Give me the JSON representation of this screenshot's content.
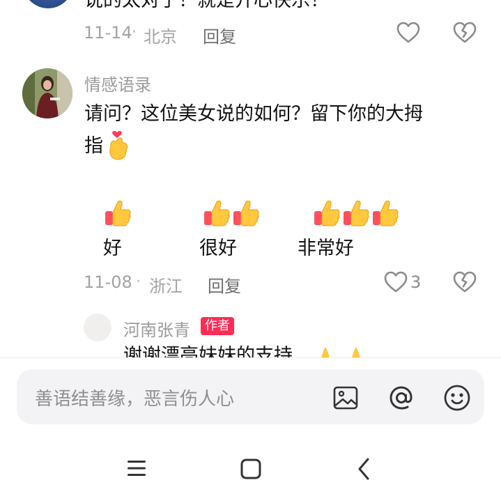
{
  "comment1": {
    "text": "说的太对了！就是开心快乐！",
    "date": "11-14",
    "location": "北京",
    "reply_label": "回复"
  },
  "comment2": {
    "author": "情感语录",
    "text_line1": "请问？这位美女说的如何？留下你的大拇",
    "text_line2": "指",
    "options": [
      {
        "thumbs": 1,
        "label": "好"
      },
      {
        "thumbs": 2,
        "label": "很好"
      },
      {
        "thumbs": 3,
        "label": "非常好"
      }
    ],
    "date": "11-08",
    "location": "浙江",
    "reply_label": "回复",
    "like_count": "3"
  },
  "reply1": {
    "author": "河南张青",
    "author_badge": "作者",
    "text": "谢谢漂亮妹妹的支持"
  },
  "input": {
    "placeholder": "善语结善缘，恶言伤人心"
  },
  "separator": "·",
  "icons": {
    "like": "heart-outline-icon",
    "dislike": "broken-heart-icon",
    "image": "image-icon",
    "mention": "at-icon",
    "emoji": "smile-icon",
    "nav_menu": "menu-icon",
    "nav_home": "square-icon",
    "nav_back": "back-chevron-icon"
  },
  "colors": {
    "badge": "#fe2c55",
    "meta_text": "#a3a3a3",
    "input_bg": "#f3f3f5"
  }
}
